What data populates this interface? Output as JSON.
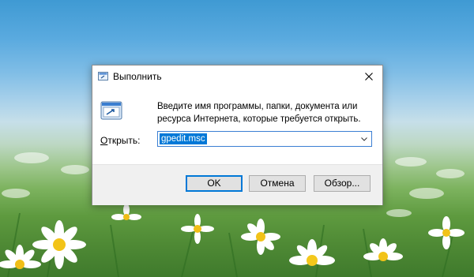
{
  "dialog": {
    "title": "Выполнить",
    "description": "Введите имя программы, папки, документа или ресурса Интернета, которые требуется открыть.",
    "open_label_accel": "О",
    "open_label_rest": "ткрыть:",
    "input_value": "gpedit.msc",
    "buttons": {
      "ok": "OK",
      "cancel": "Отмена",
      "browse": "Обзор..."
    }
  },
  "icons": {
    "title": "run-app-icon",
    "app": "run-app-icon",
    "close": "close-icon",
    "dropdown": "chevron-down-icon"
  },
  "colors": {
    "accent": "#0078d7",
    "footer": "#f0f0f0",
    "button_face": "#e1e1e1"
  }
}
